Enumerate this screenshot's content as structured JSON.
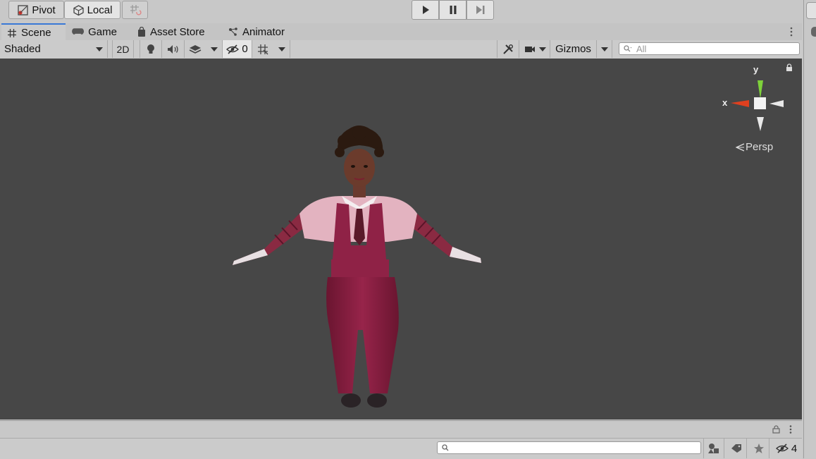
{
  "toolbar": {
    "pivot_label": "Pivot",
    "local_label": "Local"
  },
  "tabs": [
    {
      "label": "Scene",
      "icon": "grid-icon"
    },
    {
      "label": "Game",
      "icon": "gamepad-icon"
    },
    {
      "label": "Asset Store",
      "icon": "shopping-bag-icon"
    },
    {
      "label": "Animator",
      "icon": "animator-icon"
    }
  ],
  "scene_toolbar": {
    "draw_mode": "Shaded",
    "two_d_label": "2D",
    "hidden_count": "0",
    "gizmos_label": "Gizmos",
    "search_placeholder": "All"
  },
  "viewport": {
    "background_color": "#474747",
    "gizmo": {
      "y_label": "y",
      "x_label": "x",
      "projection_label": "Persp"
    }
  },
  "bottom_panel": {
    "hidden_count": "4",
    "search_placeholder": ""
  },
  "colors": {
    "selected_tab_accent": "#3a79d6",
    "axis_x": "#e0401f",
    "axis_y": "#7ed23a"
  }
}
